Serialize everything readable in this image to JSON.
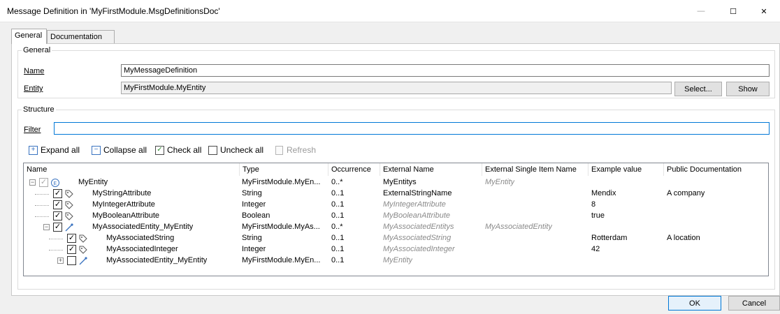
{
  "window": {
    "title": "Message Definition in 'MyFirstModule.MsgDefinitionsDoc'",
    "minimize_glyph": "—",
    "maximize_glyph": "☐",
    "close_glyph": "✕"
  },
  "tabs": [
    {
      "label": "General",
      "active": true
    },
    {
      "label": "Documentation",
      "active": false
    }
  ],
  "general": {
    "group_label": "General",
    "name_label": "Name",
    "name_value": "MyMessageDefinition",
    "entity_label": "Entity",
    "entity_value": "MyFirstModule.MyEntity",
    "select_button": "Select...",
    "show_button": "Show"
  },
  "structure": {
    "group_label": "Structure",
    "filter_label": "Filter",
    "filter_value": "",
    "toolbar": {
      "expand_all": "Expand all",
      "collapse_all": "Collapse all",
      "check_all": "Check all",
      "uncheck_all": "Uncheck all",
      "refresh": "Refresh"
    },
    "columns": [
      "Name",
      "Type",
      "Occurrence",
      "External Name",
      "External Single Item Name",
      "Example value",
      "Public Documentation"
    ],
    "rows": [
      {
        "name": "MyEntity",
        "type": "MyFirstModule.MyEn...",
        "occurrence": "0..*",
        "external_name": "MyEntitys",
        "external_single": "MyEntity",
        "example": "",
        "doc": "",
        "depth": 0,
        "kind": "entity",
        "expander": "minus",
        "checked": true,
        "dim": true
      },
      {
        "name": "MyStringAttribute",
        "type": "String",
        "occurrence": "0..1",
        "external_name": "ExternalStringName",
        "external_single": "",
        "example": "Mendix",
        "doc": "A company",
        "depth": 1,
        "kind": "attribute",
        "expander": "",
        "checked": true,
        "dim": false
      },
      {
        "name": "MyIntegerAttribute",
        "type": "Integer",
        "occurrence": "0..1",
        "external_name": "MyIntegerAttribute",
        "external_single": "",
        "example": "8",
        "doc": "",
        "depth": 1,
        "kind": "attribute",
        "expander": "",
        "checked": true,
        "dim": false
      },
      {
        "name": "MyBooleanAttribute",
        "type": "Boolean",
        "occurrence": "0..1",
        "external_name": "MyBooleanAttribute",
        "external_single": "",
        "example": "true",
        "doc": "",
        "depth": 1,
        "kind": "attribute",
        "expander": "",
        "checked": true,
        "dim": false
      },
      {
        "name": "MyAssociatedEntity_MyEntity",
        "type": "MyFirstModule.MyAs...",
        "occurrence": "0..*",
        "external_name": "MyAssociatedEntitys",
        "external_single": "MyAssociatedEntity",
        "example": "",
        "doc": "",
        "depth": 1,
        "kind": "association",
        "expander": "minus",
        "checked": true,
        "dim": false
      },
      {
        "name": "MyAssociatedString",
        "type": "String",
        "occurrence": "0..1",
        "external_name": "MyAssociatedString",
        "external_single": "",
        "example": "Rotterdam",
        "doc": "A location",
        "depth": 2,
        "kind": "attribute",
        "expander": "",
        "checked": true,
        "dim": false
      },
      {
        "name": "MyAssociatedInteger",
        "type": "Integer",
        "occurrence": "0..1",
        "external_name": "MyAssociatedInteger",
        "external_single": "",
        "example": "42",
        "doc": "",
        "depth": 2,
        "kind": "attribute",
        "expander": "",
        "checked": true,
        "dim": false
      },
      {
        "name": "MyAssociatedEntity_MyEntity",
        "type": "MyFirstModule.MyEn...",
        "occurrence": "0..1",
        "external_name": "MyEntity",
        "external_single": "",
        "example": "",
        "doc": "",
        "depth": 2,
        "kind": "association",
        "expander": "plus",
        "checked": false,
        "dim": false
      }
    ],
    "italic_external": [
      false,
      false,
      true,
      true,
      true,
      true,
      true,
      true
    ]
  },
  "footer": {
    "ok_button": "OK",
    "cancel_button": "Cancel"
  },
  "colors": {
    "accent": "#0078d7",
    "entity_icon": "#3a73c0",
    "italic_text": "#8a8a8a"
  }
}
